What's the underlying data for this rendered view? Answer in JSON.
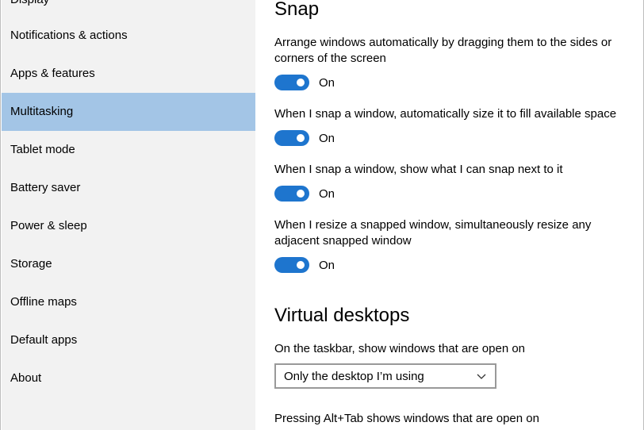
{
  "sidebar": {
    "items": [
      {
        "label": "Display"
      },
      {
        "label": "Notifications & actions"
      },
      {
        "label": "Apps & features"
      },
      {
        "label": "Multitasking",
        "selected": true
      },
      {
        "label": "Tablet mode"
      },
      {
        "label": "Battery saver"
      },
      {
        "label": "Power & sleep"
      },
      {
        "label": "Storage"
      },
      {
        "label": "Offline maps"
      },
      {
        "label": "Default apps"
      },
      {
        "label": "About"
      }
    ]
  },
  "snap": {
    "title": "Snap",
    "settings": [
      {
        "text": "Arrange windows automatically by dragging them to the sides or corners of the screen",
        "state": "On"
      },
      {
        "text": "When I snap a window, automatically size it to fill available space",
        "state": "On"
      },
      {
        "text": "When I snap a window, show what I can snap next to it",
        "state": "On"
      },
      {
        "text": "When I resize a snapped window, simultaneously resize any adjacent snapped window",
        "state": "On"
      }
    ]
  },
  "virtual_desktops": {
    "title": "Virtual desktops",
    "taskbar_label": "On the taskbar, show windows that are open on",
    "taskbar_value": "Only the desktop I’m using",
    "alttab_label": "Pressing Alt+Tab shows windows that are open on"
  },
  "colors": {
    "accent": "#1e75ce",
    "selected_nav": "#a3c5e6",
    "sidebar_bg": "#f2f2f2"
  }
}
